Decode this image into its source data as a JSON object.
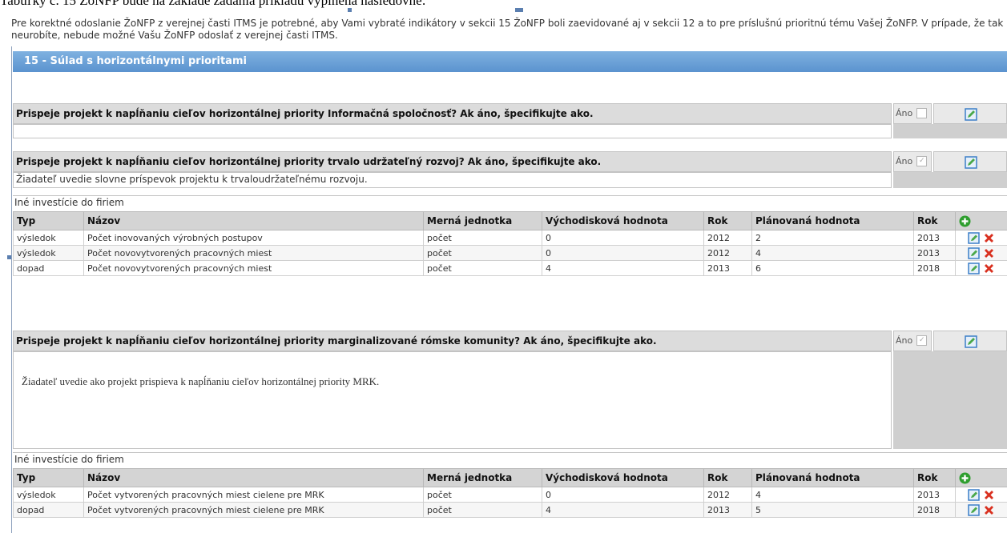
{
  "top_caption": "Tabuľky č. 15 ŽoNFP bude na základe zadania príkladu vyplnená nasledovne:",
  "intro": "Pre korektné odoslanie ŽoNFP z verejnej časti ITMS je potrebné, aby Vami vybraté indikátory v sekcii 15 ŽoNFP boli zaevidované aj v sekcii 12 a to pre príslušnú prioritnú tému Vašej ŽoNFP. V prípade, že tak neurobíte, nebude možné Vašu ŽoNFP odoslať z verejnej časti ITMS.",
  "section_title": "15 - Súlad s horizontálnymi prioritami",
  "ano_label": "Áno",
  "questions": [
    {
      "question": "Prispeje projekt k napĺňaniu cieľov horizontálnej priority Informačná spoločnosť? Ak áno, špecifikujte ako.",
      "answer": ""
    },
    {
      "question": "Prispeje projekt k napĺňaniu cieľov horizontálnej priority trvalo udržateľný rozvoj? Ak áno, špecifikujte ako.",
      "answer": "Žiadateľ uvedie slovne príspevok projektu k trvaloudržateľnému rozvoju."
    },
    {
      "question": "Prispeje projekt k napĺňaniu cieľov horizontálnej priority marginalizované rómske komunity? Ak áno, špecifikujte ako.",
      "answer": "Žiadateľ uvedie ako projekt prispieva k napĺňaniu cieľov horizontálnej priority MRK."
    }
  ],
  "table_caption": "Iné investície do firiem",
  "columns": [
    "Typ",
    "Názov",
    "Merná jednotka",
    "Východisková hodnota",
    "Rok",
    "Plánovaná hodnota",
    "Rok"
  ],
  "table1_rows": [
    [
      "výsledok",
      "Počet inovovaných výrobných postupov",
      "počet",
      "0",
      "2012",
      "2",
      "2013"
    ],
    [
      "výsledok",
      "Počet novovytvorených pracovných miest",
      "počet",
      "0",
      "2012",
      "4",
      "2013"
    ],
    [
      "dopad",
      "Počet novovytvorených pracovných miest",
      "počet",
      "4",
      "2013",
      "6",
      "2018"
    ]
  ],
  "table2_rows": [
    [
      "výsledok",
      "Počet vytvorených pracovných miest cielene pre MRK",
      "počet",
      "0",
      "2012",
      "4",
      "2013"
    ],
    [
      "dopad",
      "Počet vytvorených pracovných miest cielene pre MRK",
      "počet",
      "4",
      "2013",
      "5",
      "2018"
    ]
  ],
  "colors": {
    "header_blue": "#5b93cf",
    "add_green": "#2e9e2e",
    "delete_red": "#d9301f",
    "edit_blue": "#3c7fc8"
  }
}
